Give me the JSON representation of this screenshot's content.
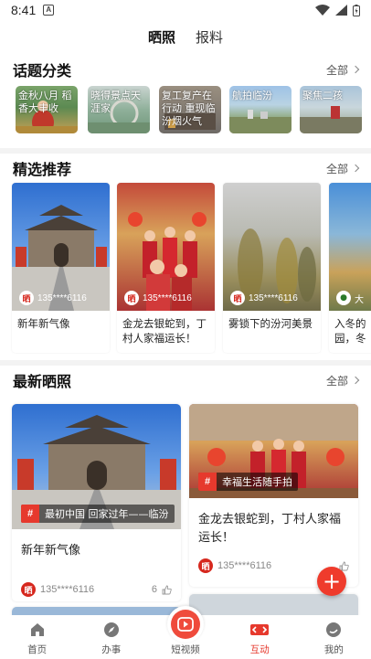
{
  "status_bar": {
    "time": "8:41",
    "notification_letter": "A"
  },
  "top_tabs": [
    {
      "label": "晒照",
      "active": true
    },
    {
      "label": "报料",
      "active": false
    }
  ],
  "topics": {
    "title": "话题分类",
    "more_label": "全部",
    "items": [
      {
        "label": "金秋八月 稻香大丰收"
      },
      {
        "label": "晓得景点天涯家"
      },
      {
        "label": "复工复产在行动 重现临汾烟火气"
      },
      {
        "label": "航拍临汾"
      },
      {
        "label": "聚焦二孩"
      }
    ]
  },
  "picks": {
    "title": "精选推荐",
    "more_label": "全部",
    "items": [
      {
        "user": "135****6116",
        "text": "新年新气像"
      },
      {
        "user": "135****6116",
        "text": "金龙去银蛇到，丁村人家福运长！"
      },
      {
        "user": "135****6116",
        "text": "雾锁下的汾河美景"
      },
      {
        "user": "大",
        "text": "入冬的园，冬"
      }
    ]
  },
  "latest": {
    "title": "最新晒照",
    "more_label": "全部",
    "items": [
      {
        "tag": "最初中国 回家过年——临汾",
        "title": "新年新气像",
        "user": "135****6116",
        "likes": "6"
      },
      {
        "tag": "幸福生活随手拍",
        "title": "金龙去银蛇到，丁村人家福运长！",
        "user": "135****6116",
        "likes": ""
      }
    ]
  },
  "fab_label": "+",
  "bottom_nav": [
    {
      "label": "首页",
      "icon": "home-icon",
      "active": false
    },
    {
      "label": "办事",
      "icon": "compass-icon",
      "active": false
    },
    {
      "label": "短视频",
      "icon": "play-icon",
      "active": false
    },
    {
      "label": "互动",
      "icon": "interact-icon",
      "active": true
    },
    {
      "label": "我的",
      "icon": "chat-profile-icon",
      "active": false
    }
  ],
  "brand_logo_glyph": "晒",
  "colors": {
    "accent": "#e6392d",
    "fab": "#ef3b2c"
  }
}
